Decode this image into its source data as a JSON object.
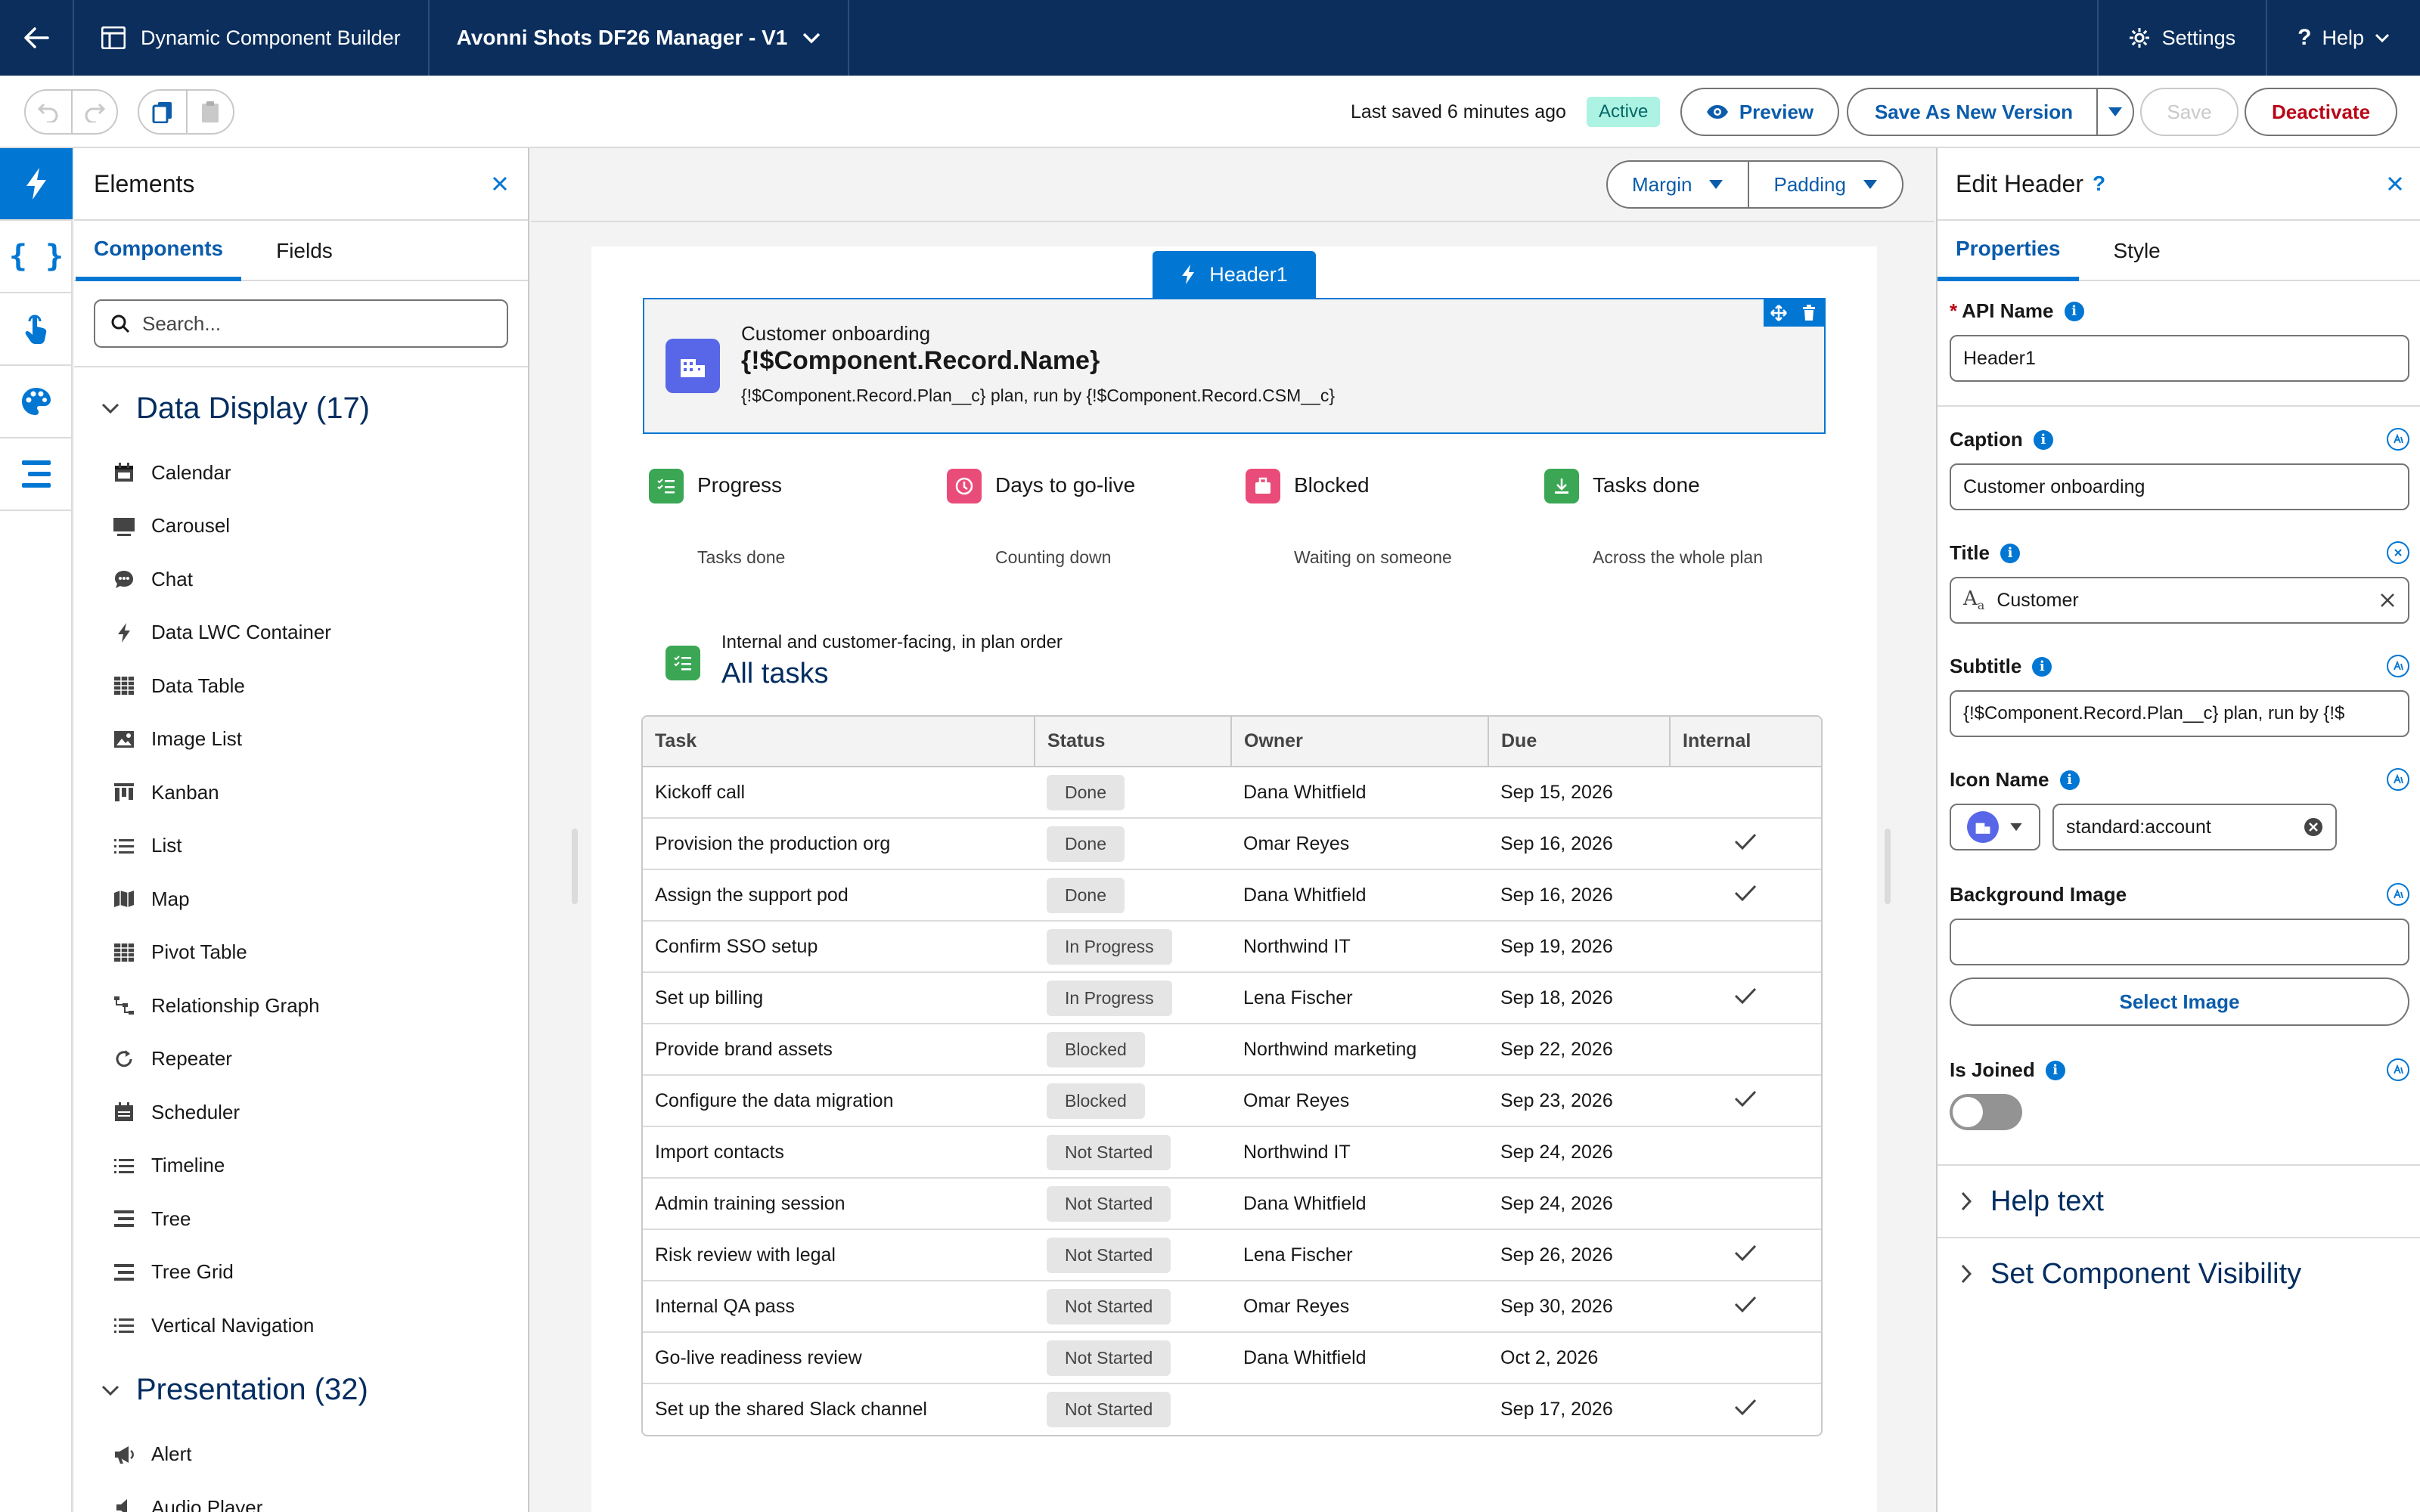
{
  "topbar": {
    "app_title": "Dynamic Component Builder",
    "component_title": "Avonni Shots DF26 Manager - V1",
    "settings_label": "Settings",
    "help_label": "Help"
  },
  "toolbar": {
    "last_saved": "Last saved 6 minutes ago",
    "status_badge": "Active",
    "preview_label": "Preview",
    "save_new_version_label": "Save As New Version",
    "save_label": "Save",
    "deactivate_label": "Deactivate"
  },
  "elements_panel": {
    "title": "Elements",
    "tabs": [
      "Components",
      "Fields"
    ],
    "search_placeholder": "Search...",
    "sections": [
      {
        "label": "Data Display (17)",
        "items": [
          "Calendar",
          "Carousel",
          "Chat",
          "Data LWC Container",
          "Data Table",
          "Image List",
          "Kanban",
          "List",
          "Map",
          "Pivot Table",
          "Relationship Graph",
          "Repeater",
          "Scheduler",
          "Timeline",
          "Tree",
          "Tree Grid",
          "Vertical Navigation"
        ]
      },
      {
        "label": "Presentation (32)",
        "items": [
          "Alert",
          "Audio Player"
        ]
      }
    ]
  },
  "canvas": {
    "margin_label": "Margin",
    "padding_label": "Padding",
    "header_tag": "Header1",
    "header": {
      "caption": "Customer onboarding",
      "title": "{!$Component.Record.Name}",
      "subtitle": "{!$Component.Record.Plan__c} plan, run by {!$Component.Record.CSM__c}"
    },
    "metrics": [
      {
        "label": "Progress",
        "sub": "Tasks done",
        "color": "#3ba755"
      },
      {
        "label": "Days to go-live",
        "sub": "Counting down",
        "color": "#ea4c7a"
      },
      {
        "label": "Blocked",
        "sub": "Waiting on someone",
        "color": "#ea4c7a"
      },
      {
        "label": "Tasks done",
        "sub": "Across the whole plan",
        "color": "#3ba755"
      }
    ],
    "tasks_caption": "Internal and customer-facing, in plan order",
    "tasks_title": "All tasks",
    "table": {
      "columns": [
        "Task",
        "Status",
        "Owner",
        "Due",
        "Internal"
      ],
      "rows": [
        [
          "Kickoff call",
          "Done",
          "Dana Whitfield",
          "Sep 15, 2026",
          false
        ],
        [
          "Provision the production org",
          "Done",
          "Omar Reyes",
          "Sep 16, 2026",
          true
        ],
        [
          "Assign the support pod",
          "Done",
          "Dana Whitfield",
          "Sep 16, 2026",
          true
        ],
        [
          "Confirm SSO setup",
          "In Progress",
          "Northwind IT",
          "Sep 19, 2026",
          false
        ],
        [
          "Set up billing",
          "In Progress",
          "Lena Fischer",
          "Sep 18, 2026",
          true
        ],
        [
          "Provide brand assets",
          "Blocked",
          "Northwind marketing",
          "Sep 22, 2026",
          false
        ],
        [
          "Configure the data migration",
          "Blocked",
          "Omar Reyes",
          "Sep 23, 2026",
          true
        ],
        [
          "Import contacts",
          "Not Started",
          "Northwind IT",
          "Sep 24, 2026",
          false
        ],
        [
          "Admin training session",
          "Not Started",
          "Dana Whitfield",
          "Sep 24, 2026",
          false
        ],
        [
          "Risk review with legal",
          "Not Started",
          "Lena Fischer",
          "Sep 26, 2026",
          true
        ],
        [
          "Internal QA pass",
          "Not Started",
          "Omar Reyes",
          "Sep 30, 2026",
          true
        ],
        [
          "Go-live readiness review",
          "Not Started",
          "Dana Whitfield",
          "Oct 2, 2026",
          false
        ],
        [
          "Set up the shared Slack channel",
          "Not Started",
          "",
          "Sep 17, 2026",
          true
        ]
      ]
    }
  },
  "properties_panel": {
    "title": "Edit Header",
    "tabs": [
      "Properties",
      "Style"
    ],
    "api_name_label": "API Name",
    "api_name_value": "Header1",
    "caption_label": "Caption",
    "caption_value": "Customer onboarding",
    "title_label": "Title",
    "title_value": "Customer",
    "subtitle_label": "Subtitle",
    "subtitle_value": "{!$Component.Record.Plan__c} plan, run by {!$",
    "icon_name_label": "Icon Name",
    "icon_name_value": "standard:account",
    "background_image_label": "Background Image",
    "background_image_value": "",
    "select_image_label": "Select Image",
    "is_joined_label": "Is Joined",
    "is_joined": false,
    "accordions": [
      "Help text",
      "Set Component Visibility"
    ]
  },
  "colors": {
    "topbar": "#0b2e5c",
    "brand": "#0176d3",
    "link": "#0b5cab",
    "deactivate": "#ba0517",
    "active_badge_bg": "#acf3e4"
  }
}
